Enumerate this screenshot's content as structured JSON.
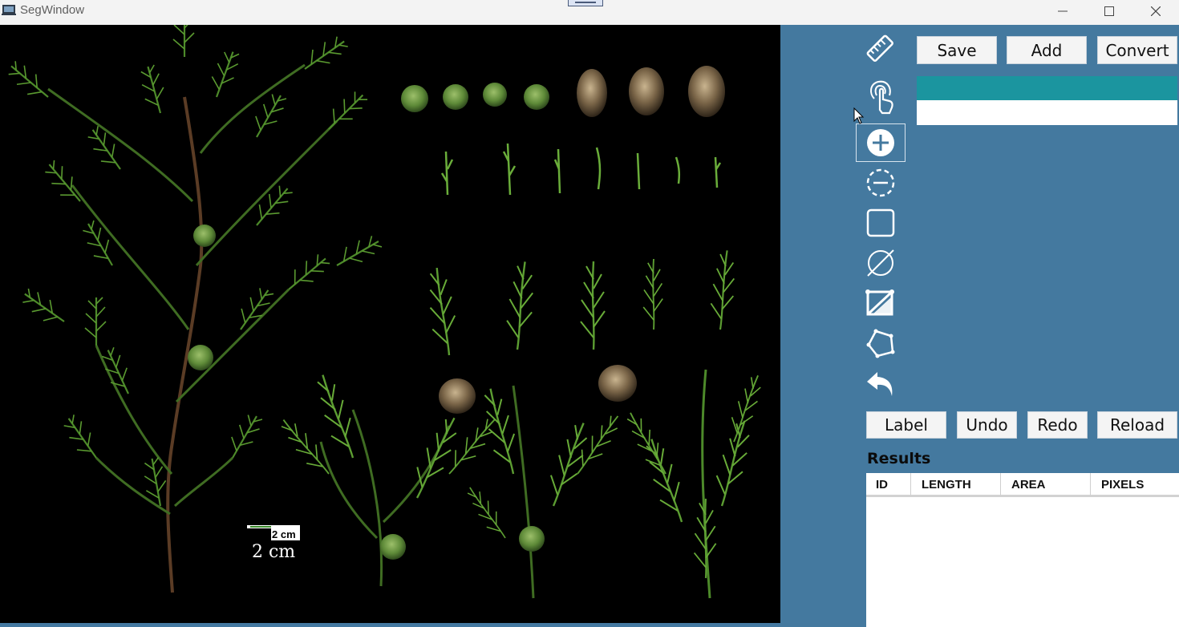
{
  "window": {
    "title": "SegWindow"
  },
  "canvas": {
    "scale_bar_small_label": "2 cm",
    "scale_bar_large_label": "2 cm"
  },
  "toolbar": {
    "tools": [
      {
        "name": "ruler-icon",
        "selected": false
      },
      {
        "name": "touch-hand-icon",
        "selected": false
      },
      {
        "name": "add-circle-icon",
        "selected": true
      },
      {
        "name": "remove-dashed-circle-icon",
        "selected": false
      },
      {
        "name": "square-icon",
        "selected": false
      },
      {
        "name": "empty-set-icon",
        "selected": false
      },
      {
        "name": "crop-diagonal-icon",
        "selected": false
      },
      {
        "name": "polygon-icon",
        "selected": false
      },
      {
        "name": "undo-arrow-icon",
        "selected": false
      }
    ]
  },
  "actions": {
    "save": "Save",
    "add": "Add",
    "convert": "Convert",
    "label": "Label",
    "undo": "Undo",
    "redo": "Redo",
    "reload": "Reload"
  },
  "results": {
    "title": "Results",
    "columns": [
      "ID",
      "LENGTH",
      "AREA",
      "PIXELS"
    ]
  },
  "colors": {
    "panel": "#44799f",
    "selected_row": "#1b959f",
    "canvas": "#000000"
  }
}
